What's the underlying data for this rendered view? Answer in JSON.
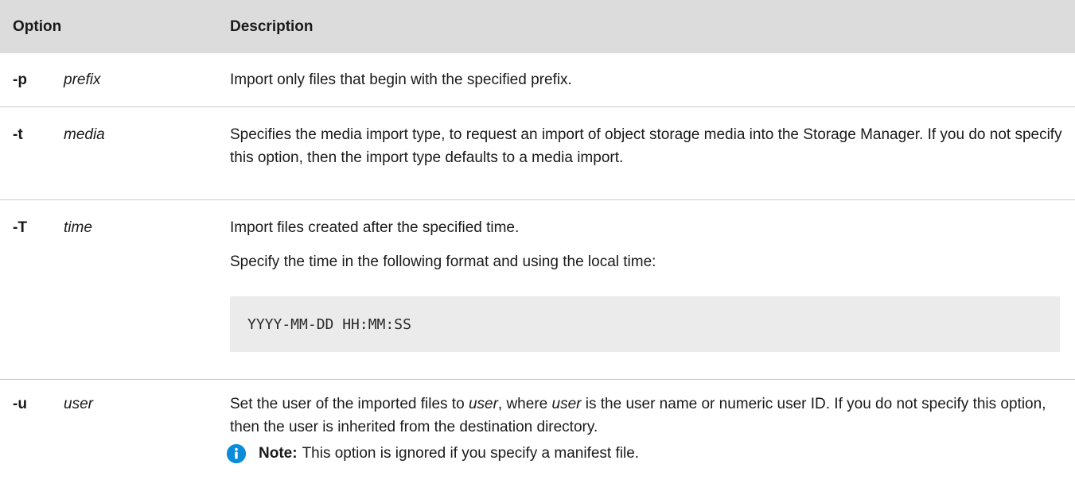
{
  "header": {
    "option": "Option",
    "description": "Description"
  },
  "rows": {
    "p": {
      "flag": "-p",
      "arg": "prefix",
      "desc": "Import only files that begin with the specified prefix."
    },
    "t": {
      "flag": "-t",
      "arg": "media",
      "desc": "Specifies the media import type, to request an import of object storage media into the Storage Manager. If you do not specify this option, then the import type defaults to a media import."
    },
    "T": {
      "flag": "-T",
      "arg": "time",
      "desc1": "Import files created after the specified time.",
      "desc2": "Specify the time in the following format and using the local time:",
      "code": "YYYY-MM-DD HH:MM:SS"
    },
    "u": {
      "flag": "-u",
      "arg": "user",
      "desc_a": "Set the user of the imported files to ",
      "desc_b": "user",
      "desc_c": ", where ",
      "desc_d": "user",
      "desc_e": " is the user name or numeric user ID. If you do not specify this option, then the user is inherited from the destination directory.",
      "note_label": "Note:",
      "note_text": "This option is ignored if you specify a manifest file.",
      "note_icon": "info-icon"
    }
  },
  "colors": {
    "header_bg": "#dcdcdc",
    "code_bg": "#ebebeb",
    "info_icon": "#0a8cd9"
  }
}
